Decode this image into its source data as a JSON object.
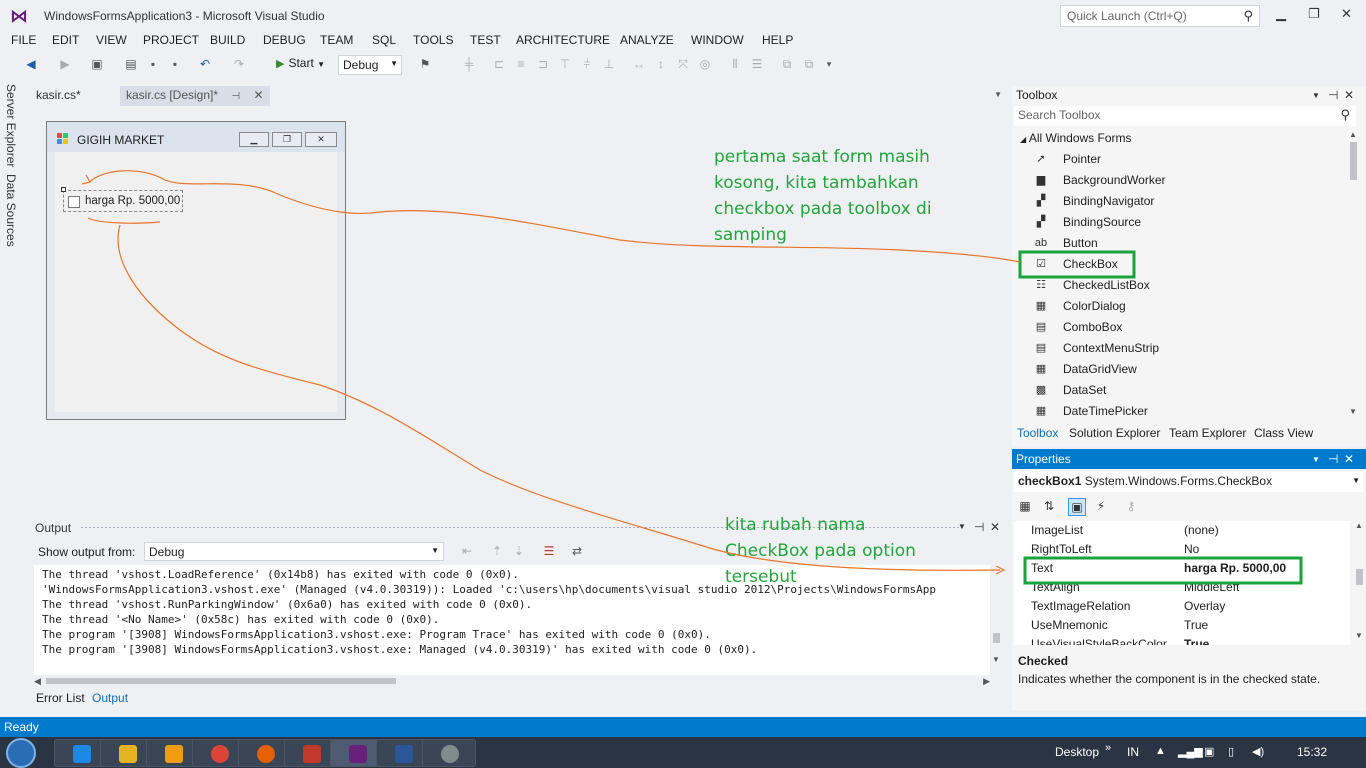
{
  "window": {
    "title": "WindowsFormsApplication3 - Microsoft Visual Studio",
    "quick_launch_placeholder": "Quick Launch (Ctrl+Q)"
  },
  "menu": [
    "FILE",
    "EDIT",
    "VIEW",
    "PROJECT",
    "BUILD",
    "DEBUG",
    "TEAM",
    "SQL",
    "TOOLS",
    "TEST",
    "ARCHITECTURE",
    "ANALYZE",
    "WINDOW",
    "HELP"
  ],
  "toolbar": {
    "start_label": "Start",
    "config_value": "Debug"
  },
  "side_tabs": [
    "Server Explorer",
    "Data Sources"
  ],
  "doc_tabs": [
    {
      "label": "kasir.cs*",
      "active": false
    },
    {
      "label": "kasir.cs [Design]*",
      "active": true
    }
  ],
  "form": {
    "caption": "GIGIH MARKET",
    "checkbox_text": "harga Rp. 5000,00"
  },
  "annotations": {
    "first": "pertama saat form masih kosong, kita tambahkan checkbox pada toolbox di samping",
    "second": "kita rubah nama CheckBox pada option tersebut"
  },
  "output": {
    "title": "Output",
    "show_from_label": "Show output from:",
    "show_from_value": "Debug",
    "lines": [
      "The thread 'vshost.LoadReference' (0x14b8) has exited with code 0 (0x0).",
      "'WindowsFormsApplication3.vshost.exe' (Managed (v4.0.30319)): Loaded 'c:\\users\\hp\\documents\\visual studio 2012\\Projects\\WindowsFormsApp",
      "The thread 'vshost.RunParkingWindow' (0x6a0) has exited with code 0 (0x0).",
      "The thread '<No Name>' (0x58c) has exited with code 0 (0x0).",
      "The program '[3908] WindowsFormsApplication3.vshost.exe: Program Trace' has exited with code 0 (0x0).",
      "The program '[3908] WindowsFormsApplication3.vshost.exe: Managed (v4.0.30319)' has exited with code 0 (0x0)."
    ],
    "bottom_tabs": [
      {
        "label": "Error List",
        "active": false
      },
      {
        "label": "Output",
        "active": true
      }
    ]
  },
  "toolbox": {
    "title": "Toolbox",
    "search_placeholder": "Search Toolbox",
    "group": "All Windows Forms",
    "items": [
      "Pointer",
      "BackgroundWorker",
      "BindingNavigator",
      "BindingSource",
      "Button",
      "CheckBox",
      "CheckedListBox",
      "ColorDialog",
      "ComboBox",
      "ContextMenuStrip",
      "DataGridView",
      "DataSet",
      "DateTimePicker"
    ],
    "selected_item": "CheckBox",
    "tabs": [
      {
        "label": "Toolbox",
        "active": true
      },
      {
        "label": "Solution Explorer",
        "active": false
      },
      {
        "label": "Team Explorer",
        "active": false
      },
      {
        "label": "Class View",
        "active": false
      }
    ]
  },
  "properties": {
    "title": "Properties",
    "object_name": "checkBox1",
    "object_type": "System.Windows.Forms.CheckBox",
    "rows": [
      {
        "name": "ImageList",
        "value": "(none)",
        "bold": false
      },
      {
        "name": "RightToLeft",
        "value": "No",
        "bold": false
      },
      {
        "name": "Text",
        "value": "harga Rp. 5000,00",
        "bold": true
      },
      {
        "name": "TextAlign",
        "value": "MiddleLeft",
        "bold": false
      },
      {
        "name": "TextImageRelation",
        "value": "Overlay",
        "bold": false
      },
      {
        "name": "UseMnemonic",
        "value": "True",
        "bold": false
      },
      {
        "name": "UseVisualStyleBackColor",
        "value": "True",
        "bold": true
      }
    ],
    "description_name": "Checked",
    "description_text": "Indicates whether the component is in the checked state."
  },
  "status": {
    "text": "Ready"
  },
  "taskbar": {
    "desktop_label": "Desktop",
    "lang": "IN",
    "time": "15:32"
  },
  "colors": {
    "accent": "#007acc",
    "annotation_green": "#22a53a",
    "annotation_line": "#e8742a",
    "highlight_box": "#1aa33a"
  }
}
